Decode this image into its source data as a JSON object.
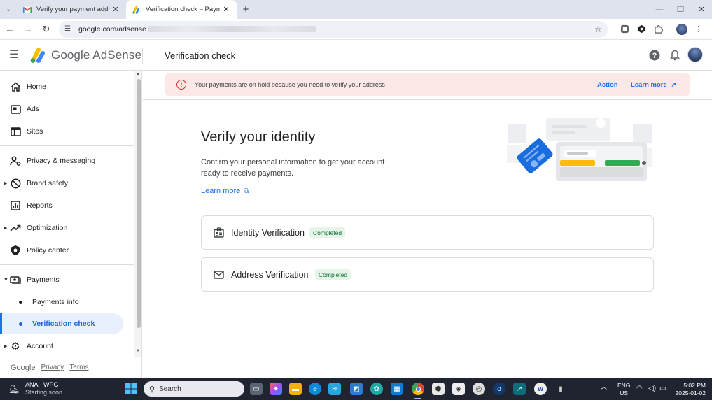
{
  "browser": {
    "tabs": [
      {
        "title": "Verify your payment address in",
        "active": false
      },
      {
        "title": "Verification check – Payments –",
        "active": true
      }
    ],
    "url": "google.com/adsense",
    "accent": "#1a73e8"
  },
  "header": {
    "brand": "Google AdSense",
    "page_title": "Verification check"
  },
  "sidebar": {
    "items": [
      {
        "label": "Home",
        "icon": "home-icon"
      },
      {
        "label": "Ads",
        "icon": "ads-icon"
      },
      {
        "label": "Sites",
        "icon": "sites-icon"
      },
      {
        "label": "Privacy & messaging",
        "icon": "privacy-icon"
      },
      {
        "label": "Brand safety",
        "icon": "block-icon"
      },
      {
        "label": "Reports",
        "icon": "reports-icon"
      },
      {
        "label": "Optimization",
        "icon": "trending-icon"
      },
      {
        "label": "Policy center",
        "icon": "shield-icon"
      },
      {
        "label": "Payments",
        "icon": "payments-icon"
      },
      {
        "label": "Payments info",
        "icon": "bullet-icon"
      },
      {
        "label": "Verification check",
        "icon": "bullet-icon",
        "active": true
      },
      {
        "label": "Account",
        "icon": "gear-icon"
      }
    ],
    "footer": {
      "google": "Google",
      "privacy": "Privacy",
      "terms": "Terms"
    }
  },
  "banner": {
    "message": "Your payments are on hold because you need to verify your address",
    "action": "Action",
    "learn_more": "Learn more",
    "color": "#fce8e6"
  },
  "main": {
    "heading": "Verify your identity",
    "description": "Confirm your personal information to get your account ready to receive payments.",
    "learn_more": "Learn more",
    "cards": [
      {
        "title": "Identity Verification",
        "status": "Completed",
        "icon": "id-badge-icon"
      },
      {
        "title": "Address Verification",
        "status": "Completed",
        "icon": "mail-icon"
      }
    ]
  },
  "taskbar": {
    "weather_title": "ANA - WPG",
    "weather_sub": "Starting soon",
    "search_placeholder": "Search",
    "lang_1": "ENG",
    "lang_2": "US",
    "time": "5:02 PM",
    "date": "2025-01-02"
  }
}
